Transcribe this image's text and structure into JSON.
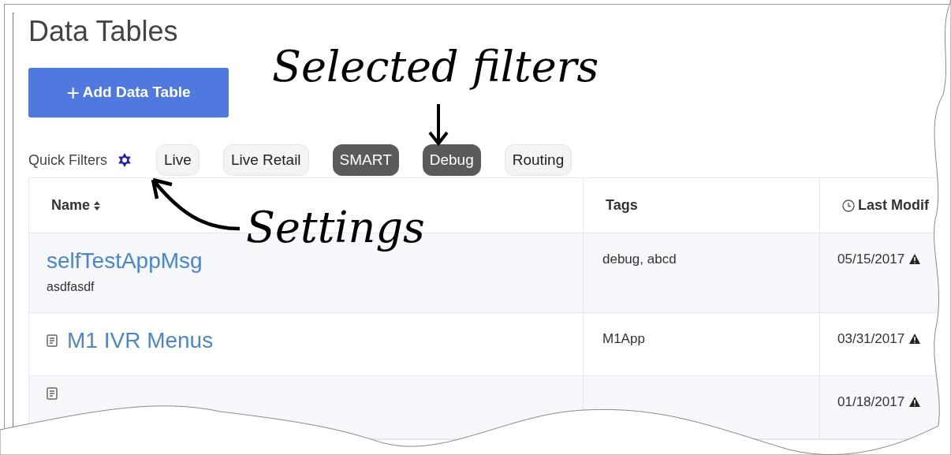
{
  "page": {
    "title": "Data Tables"
  },
  "add_button": {
    "icon": "+",
    "label": "Add Data Table"
  },
  "quick_filters": {
    "label": "Quick Filters",
    "filters": [
      {
        "label": "Live",
        "selected": false
      },
      {
        "label": "Live Retail",
        "selected": false
      },
      {
        "label": "SMART",
        "selected": true
      },
      {
        "label": "Debug",
        "selected": true
      },
      {
        "label": "Routing",
        "selected": false
      }
    ]
  },
  "table": {
    "columns": [
      {
        "label": "Name",
        "kind": "sortable"
      },
      {
        "label": "Tags",
        "kind": "plain"
      },
      {
        "label": "Last Modif",
        "kind": "time"
      }
    ],
    "rows": [
      {
        "name": "selfTestAppMsg",
        "description": "asdfasdf",
        "doc_icon": false,
        "tags": "debug, abcd",
        "modified": "05/15/2017"
      },
      {
        "name": "M1 IVR Menus",
        "doc_icon": true,
        "tags": "M1App",
        "modified": "03/31/2017"
      },
      {
        "doc_icon": true,
        "modified": "01/18/2017"
      }
    ]
  },
  "annotations": [
    {
      "kind": "selected",
      "text": "Selected filters"
    },
    {
      "kind": "settings",
      "text": "Settings"
    }
  ]
}
